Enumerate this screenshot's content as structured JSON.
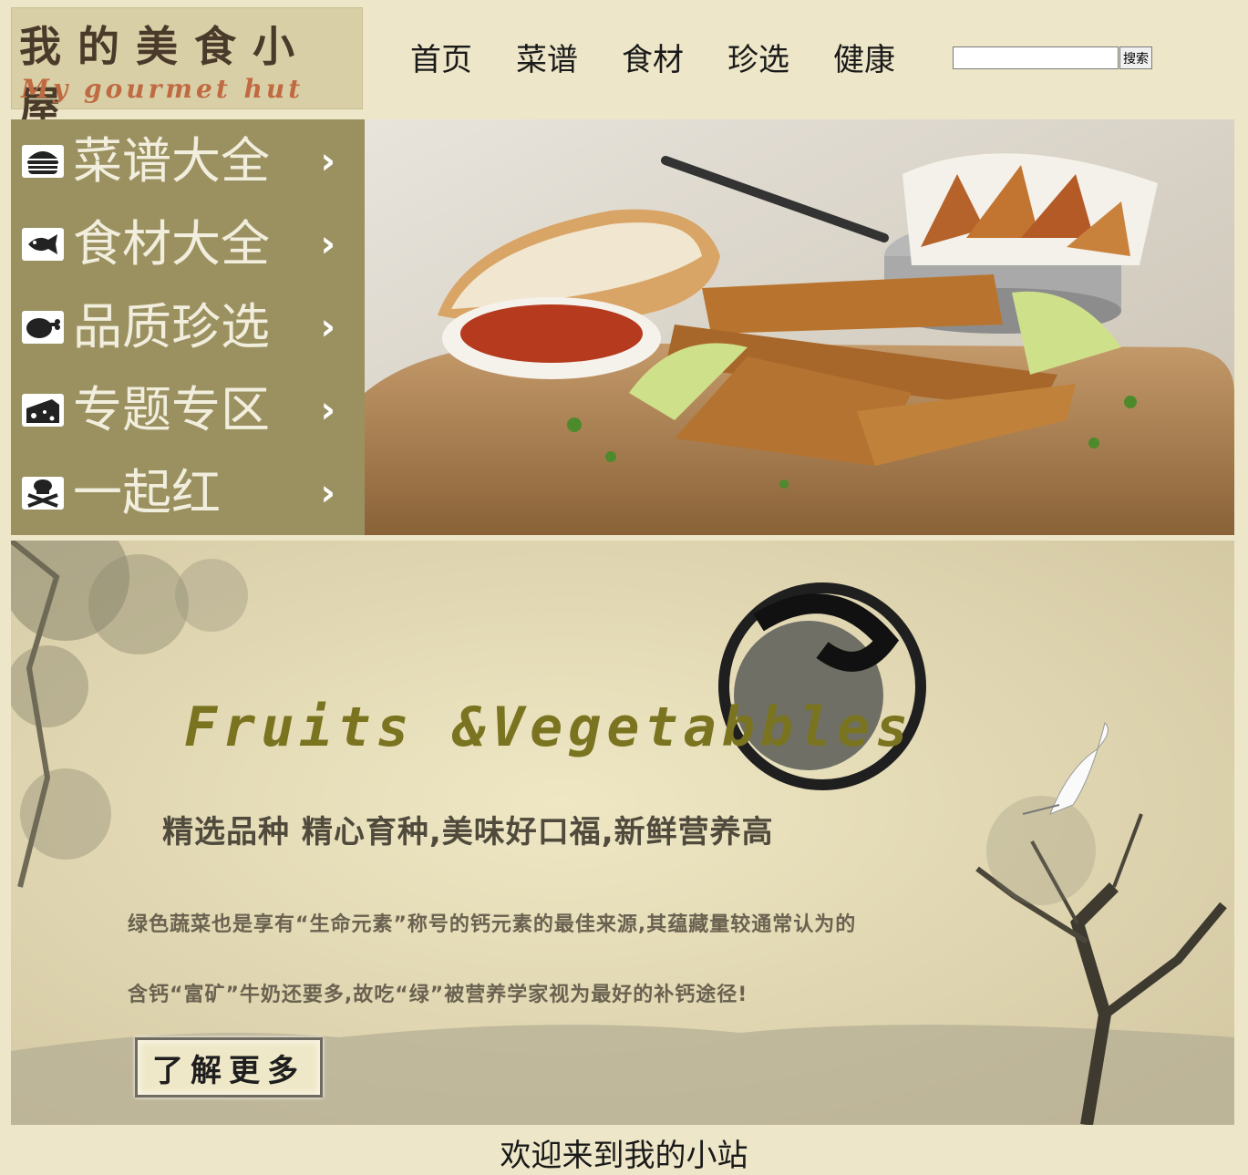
{
  "header": {
    "logo": {
      "cn": "我的美食小屋",
      "en": "My gourmet hut"
    },
    "nav": [
      "首页",
      "菜谱",
      "食材",
      "珍选",
      "健康"
    ],
    "search": {
      "placeholder": "",
      "button": "搜索"
    }
  },
  "sidebar": {
    "items": [
      {
        "label": "菜谱大全",
        "icon": "burger-icon"
      },
      {
        "label": "食材大全",
        "icon": "fish-icon"
      },
      {
        "label": "品质珍选",
        "icon": "drumstick-icon"
      },
      {
        "label": "专题专区",
        "icon": "cheese-icon"
      },
      {
        "label": "一起红",
        "icon": "chef-icon"
      }
    ],
    "chevron": "›"
  },
  "banner": {
    "title": "Fruits &Vegetabbles",
    "subtitle": "精选品种 精心育种,美味好口福,新鲜营养高",
    "body_line1": "绿色蔬菜也是享有“生命元素”称号的钙元素的最佳来源,其蕴藏量较通常认为的",
    "body_line2": "含钙“富矿”牛奶还要多,故吃“绿”被营养学家视为最好的补钙途径!",
    "button": "了解更多"
  },
  "footer": {
    "text": "欢迎来到我的小站"
  },
  "colors": {
    "page_bg": "#ede6c8",
    "sidebar_bg": "#9b9160",
    "banner_title": "#7a7420"
  }
}
